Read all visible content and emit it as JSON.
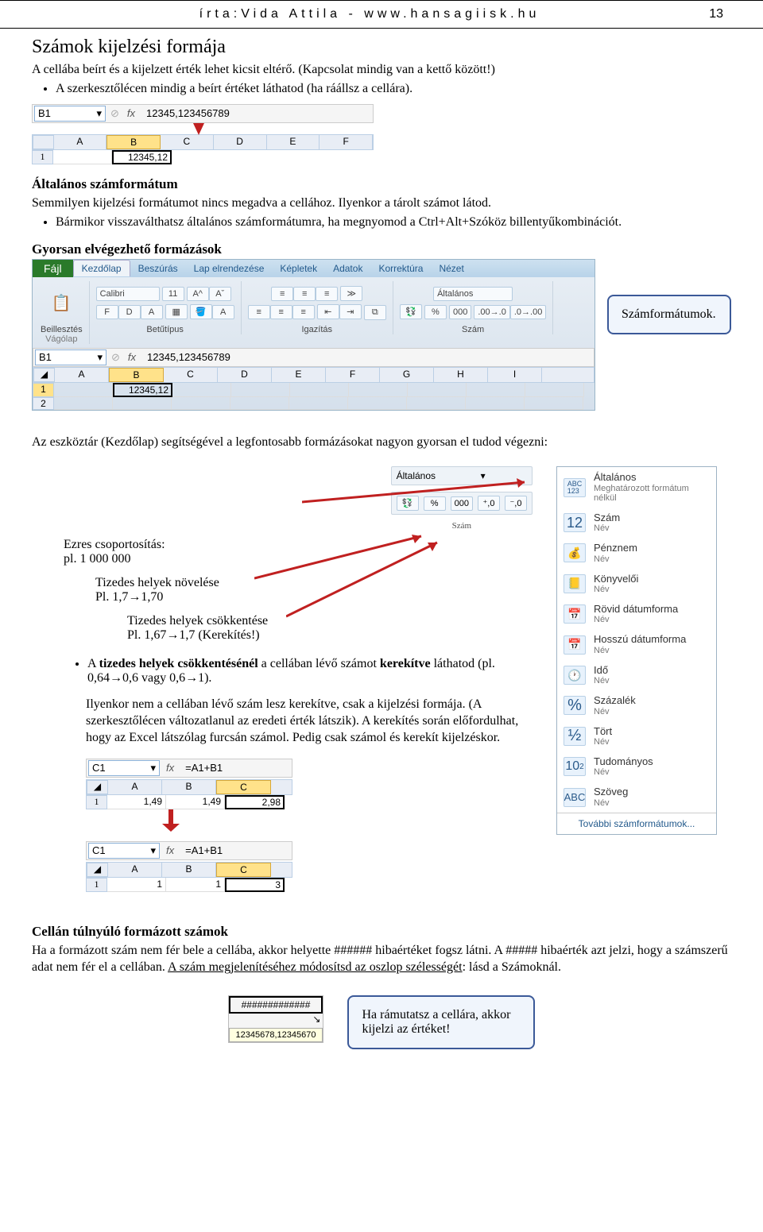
{
  "header": {
    "author_line": "írta:Vida Attila - www.hansagiisk.hu",
    "page_number": "13"
  },
  "section1": {
    "title": "Számok kijelzési formája",
    "p1": "A cellába beírt és a kijelzett érték lehet kicsit eltérő. (Kapcsolat mindig van a kettő között!)",
    "bullet1": "A szerkesztőlécen mindig a beírt értéket láthatod (ha ráállsz a cellára).",
    "formula_cell": "B1",
    "formula_value": "12345,123456789",
    "columns": [
      "A",
      "B",
      "C",
      "D",
      "E",
      "F"
    ],
    "cell_value": "12345,12"
  },
  "section2": {
    "title": "Általános számformátum",
    "p": "Semmilyen kijelzési formátumot nincs megadva a cellához. Ilyenkor a tárolt számot látod.",
    "bullet": "Bármikor visszaválthatsz általános számformátumra, ha megnyomod a Ctrl+Alt+Szóköz billentyűkombinációt."
  },
  "section3": {
    "title": "Gyorsan elvégezhető formázások",
    "callout": "Számformátumok.",
    "ribbon": {
      "file": "Fájl",
      "tabs": [
        "Kezdőlap",
        "Beszúrás",
        "Lap elrendezése",
        "Képletek",
        "Adatok",
        "Korrektúra",
        "Nézet"
      ],
      "paste": "Beillesztés",
      "clipboard": "Vágólap",
      "font_name": "Calibri",
      "font_size": "11",
      "font_group": "Betűtípus",
      "align_group": "Igazítás",
      "number_format": "Általános",
      "number_group": "Szám",
      "bold": "F",
      "italic": "D",
      "underline": "A",
      "percent": "%",
      "thousand": "000"
    },
    "formula_cell": "B1",
    "formula_value": "12345,123456789",
    "columns": [
      "A",
      "B",
      "C",
      "D",
      "E",
      "F",
      "G",
      "H",
      "I"
    ],
    "cell_value": "12345,12",
    "p_after": "Az eszköztár (Kezdőlap) segítségével a legfontosabb formázásokat nagyon gyorsan el tudod végezni:"
  },
  "section4": {
    "widget": {
      "dropdown": "Általános",
      "group_label": "Szám"
    },
    "ezres_title": "Ezres csoportosítás:",
    "ezres_ex": "pl. 1 000 000",
    "tizedes_nov": "Tizedes helyek növelése",
    "tizedes_nov_ex": "Pl. 1,7→1,70",
    "tizedes_csok": "Tizedes helyek csökkentése",
    "tizedes_csok_ex": "Pl. 1,67→1,7 (Kerekítés!)",
    "bullet": "A tizedes helyek csökkentésénél a cellában lévő számot kerekítve láthatod (pl. 0,64→0,6 vagy 0,6→1).",
    "p1": "Ilyenkor nem a cellában lévő szám lesz kerekítve, csak a kijelzési formája. (A szerkesztőlécen változatlanul az eredeti érték látszik). A kerekítés során előfordulhat, hogy az Excel látszólag furcsán számol. Pedig csak számol és kerekít kijelzéskor.",
    "format_menu": [
      {
        "icon": "ABC 123",
        "title": "Általános",
        "sub": "Meghatározott formátum nélkül"
      },
      {
        "icon": "12",
        "title": "Szám",
        "sub": "Név"
      },
      {
        "icon": "💰",
        "title": "Pénznem",
        "sub": "Név"
      },
      {
        "icon": "📒",
        "title": "Könyvelői",
        "sub": "Név"
      },
      {
        "icon": "📅",
        "title": "Rövid dátumforma",
        "sub": "Név"
      },
      {
        "icon": "📅",
        "title": "Hosszú dátumforma",
        "sub": "Név"
      },
      {
        "icon": "🕐",
        "title": "Idő",
        "sub": "Név"
      },
      {
        "icon": "%",
        "title": "Százalék",
        "sub": "Név"
      },
      {
        "icon": "½",
        "title": "Tört",
        "sub": "Név"
      },
      {
        "icon": "10²",
        "title": "Tudományos",
        "sub": "Név"
      },
      {
        "icon": "ABC",
        "title": "Szöveg",
        "sub": "Név"
      }
    ],
    "format_menu_footer": "További számformátumok...",
    "example1": {
      "cell_ref": "C1",
      "fx": "=A1+B1",
      "cols": [
        "A",
        "B",
        "C"
      ],
      "row": [
        "1,49",
        "1,49",
        "2,98"
      ]
    },
    "example2": {
      "cell_ref": "C1",
      "fx": "=A1+B1",
      "cols": [
        "A",
        "B",
        "C"
      ],
      "row": [
        "1",
        "1",
        "3"
      ]
    }
  },
  "section5": {
    "title": "Cellán túlnyúló formázott számok",
    "p": "Ha a formázott szám nem fér bele a cellába, akkor helyette ###### hibaértéket fogsz látni. A ##### hibaérték azt jelzi, hogy a számszerű adat nem fér el a cellában. A szám megjelenítéséhez módosítsd az oszlop szélességét: lásd a Számoknál.",
    "hash_value": "#############",
    "tooltip": "12345678,12345670",
    "callout": "Ha rámutatsz a cellára, akkor kijelzi az értéket!"
  }
}
